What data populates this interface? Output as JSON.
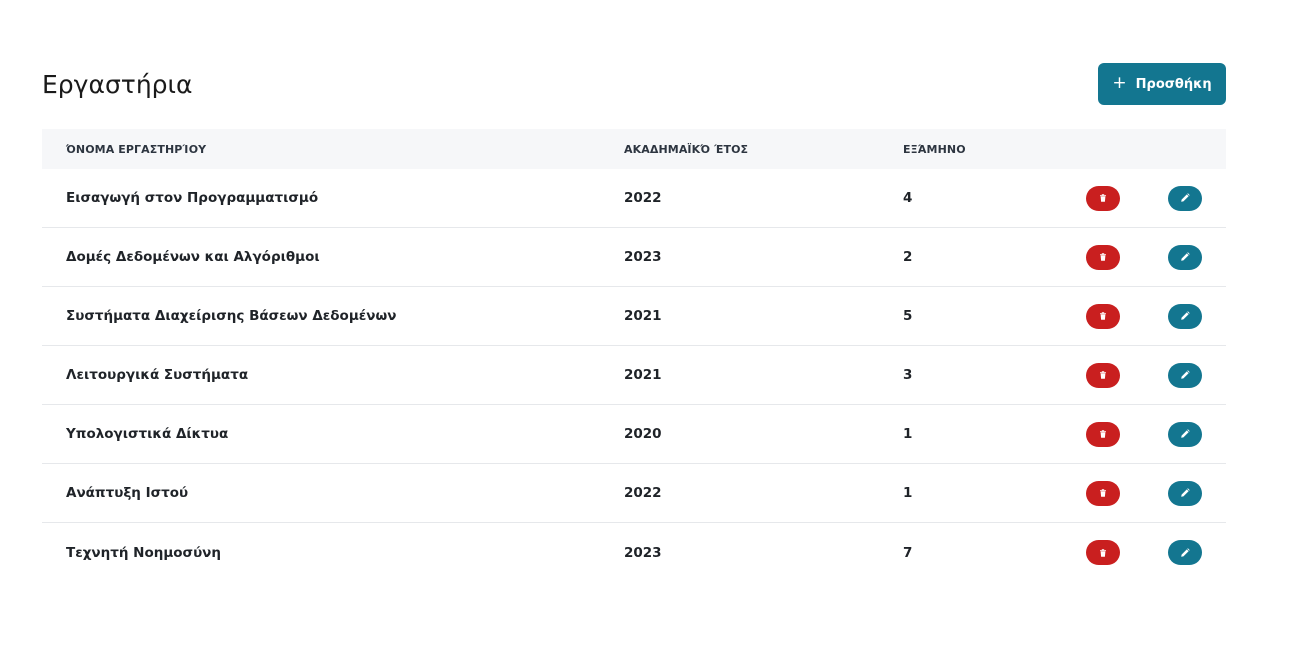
{
  "page": {
    "title": "Εργαστήρια"
  },
  "toolbar": {
    "add_label": "Προσθήκη",
    "add_icon": "plus-icon"
  },
  "colors": {
    "primary": "#137690",
    "danger": "#c91f1f",
    "header_bg": "#f6f7f9"
  },
  "table": {
    "headers": [
      "ΌΝΟΜΑ ΕΡΓΑΣΤΗΡΊΟΥ",
      "ΑΚΑΔΗΜΑΪΚΌ ΈΤΟΣ",
      "ΕΞΆΜΗΝΟ"
    ],
    "rows": [
      {
        "name": "Εισαγωγή στον Προγραμματισμό",
        "year": "2022",
        "semester": "4"
      },
      {
        "name": "Δομές Δεδομένων και Αλγόριθμοι",
        "year": "2023",
        "semester": "2"
      },
      {
        "name": "Συστήματα Διαχείρισης Βάσεων Δεδομένων",
        "year": "2021",
        "semester": "5"
      },
      {
        "name": "Λειτουργικά Συστήματα",
        "year": "2021",
        "semester": "3"
      },
      {
        "name": "Υπολογιστικά Δίκτυα",
        "year": "2020",
        "semester": "1"
      },
      {
        "name": "Ανάπτυξη Ιστού",
        "year": "2022",
        "semester": "1"
      },
      {
        "name": "Τεχνητή Νοημοσύνη",
        "year": "2023",
        "semester": "7"
      }
    ],
    "row_actions": {
      "delete_icon": "trash-icon",
      "edit_icon": "pencil-icon"
    }
  }
}
